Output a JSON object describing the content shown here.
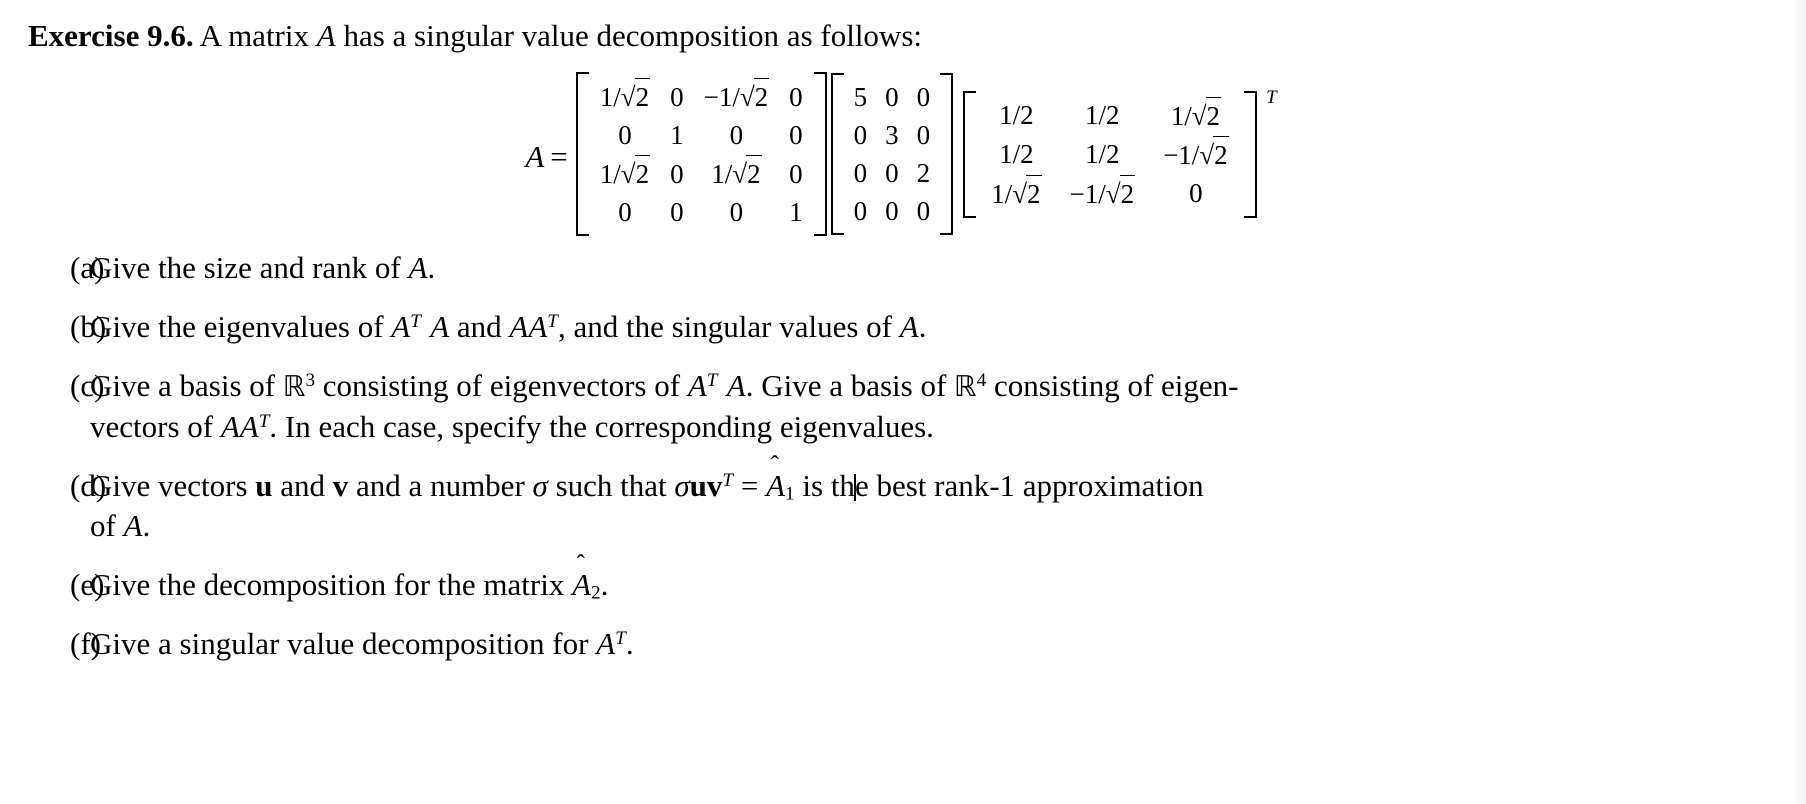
{
  "heading": {
    "label": "Exercise 9.6.",
    "text_before_A": "A matrix",
    "var_A": "A",
    "text_after_A": "has a singular value decomposition as follows:"
  },
  "equation": {
    "lhs": "A",
    "equals": "=",
    "transpose_symbol": "T",
    "matrix_U": {
      "name": "U",
      "rows": [
        [
          "1/√2",
          "0",
          "−1/√2",
          "0"
        ],
        [
          "0",
          "1",
          "0",
          "0"
        ],
        [
          "1/√2",
          "0",
          "1/√2",
          "0"
        ],
        [
          "0",
          "0",
          "0",
          "1"
        ]
      ]
    },
    "matrix_Sigma": {
      "name": "Sigma",
      "rows": [
        [
          "5",
          "0",
          "0"
        ],
        [
          "0",
          "3",
          "0"
        ],
        [
          "0",
          "0",
          "2"
        ],
        [
          "0",
          "0",
          "0"
        ]
      ]
    },
    "matrix_V": {
      "name": "V",
      "rows": [
        [
          "1/2",
          "1/2",
          "1/√2"
        ],
        [
          "1/2",
          "1/2",
          "−1/√2"
        ],
        [
          "1/√2",
          "−1/√2",
          "0"
        ]
      ]
    }
  },
  "items": [
    {
      "marker": "(a)",
      "lines": [
        [
          {
            "t": "text",
            "v": "Give the size and rank of "
          },
          {
            "t": "mi",
            "v": "A"
          },
          {
            "t": "text",
            "v": "."
          }
        ]
      ]
    },
    {
      "marker": "(b)",
      "lines": [
        [
          {
            "t": "text",
            "v": "Give the eigenvalues of "
          },
          {
            "t": "mi_sup",
            "v": "A",
            "sup": "T"
          },
          {
            "t": "sp"
          },
          {
            "t": "mi",
            "v": "A"
          },
          {
            "t": "text",
            "v": " and "
          },
          {
            "t": "mi",
            "v": "AA"
          },
          {
            "t": "sup",
            "v": "T"
          },
          {
            "t": "text",
            "v": ", and the singular values of "
          },
          {
            "t": "mi",
            "v": "A"
          },
          {
            "t": "text",
            "v": "."
          }
        ]
      ]
    },
    {
      "marker": "(c)",
      "lines": [
        [
          {
            "t": "text",
            "v": "Give a basis of "
          },
          {
            "t": "bbR_sup",
            "v": "R",
            "sup": "3"
          },
          {
            "t": "text",
            "v": " consisting of eigenvectors of "
          },
          {
            "t": "mi_sup",
            "v": "A",
            "sup": "T"
          },
          {
            "t": "sp"
          },
          {
            "t": "mi",
            "v": "A"
          },
          {
            "t": "text",
            "v": ". Give a basis of "
          },
          {
            "t": "bbR_sup",
            "v": "R",
            "sup": "4"
          },
          {
            "t": "text",
            "v": " consisting of eigen-"
          }
        ],
        [
          {
            "t": "text",
            "v": "vectors of "
          },
          {
            "t": "mi",
            "v": "AA"
          },
          {
            "t": "sup",
            "v": "T"
          },
          {
            "t": "text",
            "v": ". In each case, specify the corresponding eigenvalues."
          }
        ]
      ]
    },
    {
      "marker": "(d)",
      "lines": [
        [
          {
            "t": "text",
            "v": "Give vectors "
          },
          {
            "t": "vec",
            "v": "u"
          },
          {
            "t": "text",
            "v": " and "
          },
          {
            "t": "vec",
            "v": "v"
          },
          {
            "t": "text",
            "v": " and a number "
          },
          {
            "t": "sigma",
            "v": "σ"
          },
          {
            "t": "text",
            "v": " such that "
          },
          {
            "t": "sigma",
            "v": "σ"
          },
          {
            "t": "vec",
            "v": "uv"
          },
          {
            "t": "sup",
            "v": "T"
          },
          {
            "t": "text",
            "v": " = "
          },
          {
            "t": "hatA",
            "v": "A",
            "sub": "1"
          },
          {
            "t": "text",
            "v": " is th"
          },
          {
            "t": "caret"
          },
          {
            "t": "text",
            "v": "e best rank-1 approximation"
          }
        ],
        [
          {
            "t": "text",
            "v": "of "
          },
          {
            "t": "mi",
            "v": "A"
          },
          {
            "t": "text",
            "v": "."
          }
        ]
      ]
    },
    {
      "marker": "(e)",
      "lines": [
        [
          {
            "t": "text",
            "v": "Give the decomposition for the matrix "
          },
          {
            "t": "hatA",
            "v": "A",
            "sub": "2"
          },
          {
            "t": "text",
            "v": "."
          }
        ]
      ]
    },
    {
      "marker": "(f)",
      "lines": [
        [
          {
            "t": "text",
            "v": "Give a singular value decomposition for "
          },
          {
            "t": "mi",
            "v": "A"
          },
          {
            "t": "sup",
            "v": "T"
          },
          {
            "t": "text",
            "v": "."
          }
        ]
      ]
    }
  ]
}
